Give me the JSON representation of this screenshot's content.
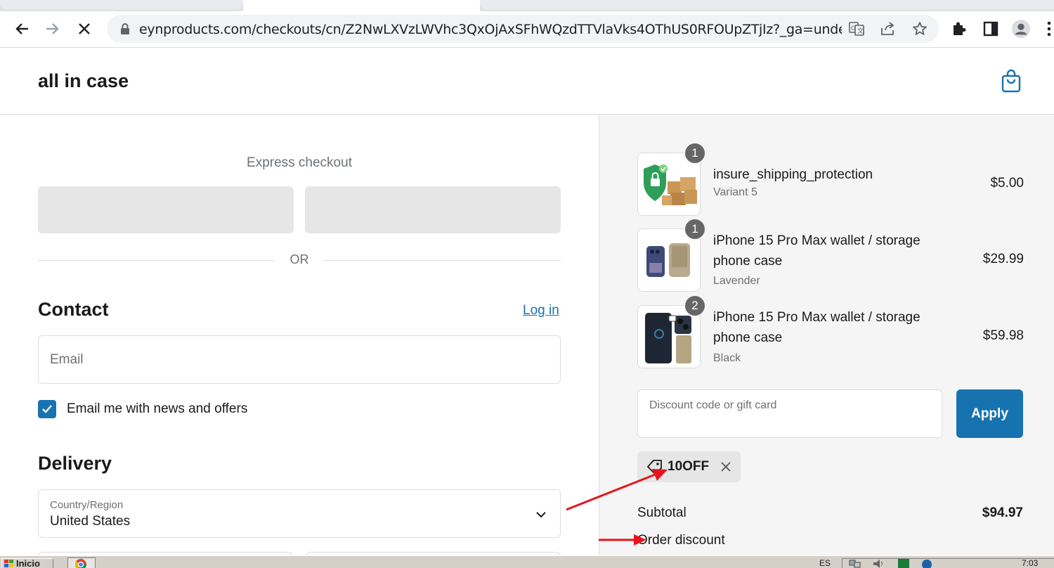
{
  "browser": {
    "url": "eynproducts.com/checkouts/cn/Z2NwLXVzLWVhc3QxOjAxSFhWQzdTTVlaVks4OThUS0RFOUpZTjIz?_ga=undefin..."
  },
  "store": {
    "title": "all in case"
  },
  "express": {
    "label": "Express checkout",
    "or": "OR"
  },
  "contact": {
    "heading": "Contact",
    "login": "Log in",
    "email_placeholder": "Email",
    "newsletter_label": "Email me with news and offers",
    "newsletter_checked": true
  },
  "delivery": {
    "heading": "Delivery",
    "country_label": "Country/Region",
    "country_value": "United States"
  },
  "cart": {
    "items": [
      {
        "quantity": "1",
        "name": "insure_shipping_protection",
        "variant": "Variant 5",
        "price": "$5.00",
        "image": "shield-boxes-image"
      },
      {
        "quantity": "1",
        "name": "iPhone 15 Pro Max wallet / storage phone case",
        "variant": "Lavender",
        "price": "$29.99",
        "image": "lavender-case-image"
      },
      {
        "quantity": "2",
        "name": "iPhone 15 Pro Max wallet / storage phone case",
        "variant": "Black",
        "price": "$59.98",
        "image": "black-case-image"
      }
    ],
    "discount_placeholder": "Discount code or gift card",
    "apply_label": "Apply",
    "applied_code": "10OFF",
    "subtotal_label": "Subtotal",
    "subtotal_value": "$94.97",
    "order_discount_label": "Order discount"
  },
  "taskbar": {
    "start_label": "Inicio",
    "lang": "ES",
    "time": "7:03"
  },
  "colors": {
    "accent": "#1773b0",
    "annotation_arrow": "#e8141c",
    "summary_bg": "#f5f5f5"
  }
}
